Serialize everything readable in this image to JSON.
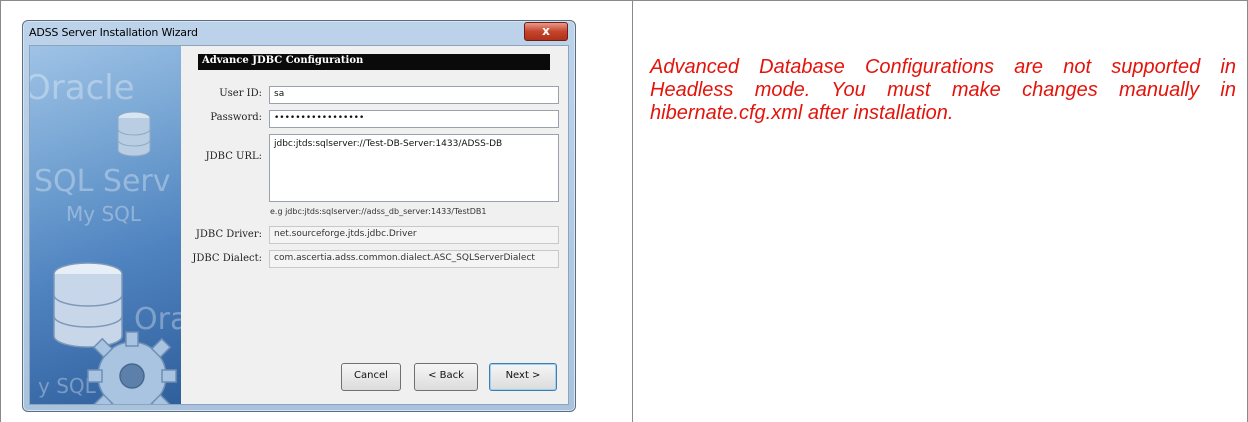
{
  "window": {
    "title": "ADSS Server Installation Wizard",
    "close_glyph": "x"
  },
  "banner": {
    "watermarks": [
      "Oracle",
      "SQL Serv",
      "My SQL",
      "Orac",
      "y SQL"
    ],
    "icons": [
      "database-icon",
      "gear-icon"
    ]
  },
  "section": {
    "heading": "Advance JDBC Configuration"
  },
  "form": {
    "user_id_label": "User ID:",
    "user_id_value": "sa",
    "password_label": "Password:",
    "password_value": "•••••••••••••••••",
    "jdbc_url_label": "JDBC URL:",
    "jdbc_url_value": "jdbc:jtds:sqlserver://Test-DB-Server:1433/ADSS-DB",
    "jdbc_url_hint": "e.g jdbc:jtds:sqlserver://adss_db_server:1433/TestDB1",
    "jdbc_driver_label": "JDBC Driver:",
    "jdbc_driver_value": "net.sourceforge.jtds.jdbc.Driver",
    "jdbc_dialect_label": "JDBC Dialect:",
    "jdbc_dialect_value": "com.ascertia.adss.common.dialect.ASC_SQLServerDialect"
  },
  "buttons": {
    "cancel": "Cancel",
    "back": "< Back",
    "next": "Next >"
  },
  "note": {
    "text": "Advanced Database Configurations are not supported in Headless mode. You must make changes manually in hibernate.cfg.xml after installation."
  },
  "colors": {
    "note_text": "#e3140b",
    "heading_bar": "#0a0a0a",
    "close_button": "#c4452c"
  }
}
